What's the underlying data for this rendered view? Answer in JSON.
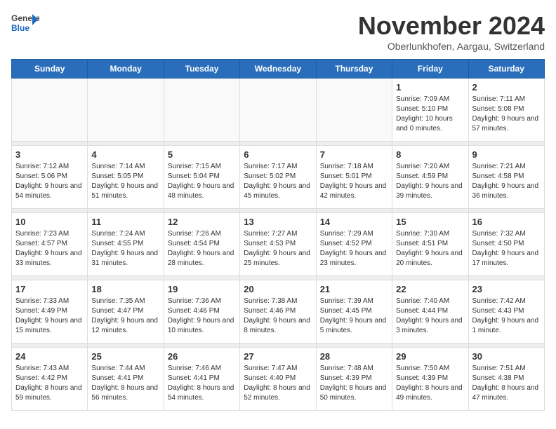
{
  "logo": {
    "text_general": "General",
    "text_blue": "Blue"
  },
  "header": {
    "title": "November 2024",
    "subtitle": "Oberlunkhofen, Aargau, Switzerland"
  },
  "weekdays": [
    "Sunday",
    "Monday",
    "Tuesday",
    "Wednesday",
    "Thursday",
    "Friday",
    "Saturday"
  ],
  "weeks": [
    [
      {
        "day": "",
        "info": ""
      },
      {
        "day": "",
        "info": ""
      },
      {
        "day": "",
        "info": ""
      },
      {
        "day": "",
        "info": ""
      },
      {
        "day": "",
        "info": ""
      },
      {
        "day": "1",
        "info": "Sunrise: 7:09 AM\nSunset: 5:10 PM\nDaylight: 10 hours and 0 minutes."
      },
      {
        "day": "2",
        "info": "Sunrise: 7:11 AM\nSunset: 5:08 PM\nDaylight: 9 hours and 57 minutes."
      }
    ],
    [
      {
        "day": "3",
        "info": "Sunrise: 7:12 AM\nSunset: 5:06 PM\nDaylight: 9 hours and 54 minutes."
      },
      {
        "day": "4",
        "info": "Sunrise: 7:14 AM\nSunset: 5:05 PM\nDaylight: 9 hours and 51 minutes."
      },
      {
        "day": "5",
        "info": "Sunrise: 7:15 AM\nSunset: 5:04 PM\nDaylight: 9 hours and 48 minutes."
      },
      {
        "day": "6",
        "info": "Sunrise: 7:17 AM\nSunset: 5:02 PM\nDaylight: 9 hours and 45 minutes."
      },
      {
        "day": "7",
        "info": "Sunrise: 7:18 AM\nSunset: 5:01 PM\nDaylight: 9 hours and 42 minutes."
      },
      {
        "day": "8",
        "info": "Sunrise: 7:20 AM\nSunset: 4:59 PM\nDaylight: 9 hours and 39 minutes."
      },
      {
        "day": "9",
        "info": "Sunrise: 7:21 AM\nSunset: 4:58 PM\nDaylight: 9 hours and 36 minutes."
      }
    ],
    [
      {
        "day": "10",
        "info": "Sunrise: 7:23 AM\nSunset: 4:57 PM\nDaylight: 9 hours and 33 minutes."
      },
      {
        "day": "11",
        "info": "Sunrise: 7:24 AM\nSunset: 4:55 PM\nDaylight: 9 hours and 31 minutes."
      },
      {
        "day": "12",
        "info": "Sunrise: 7:26 AM\nSunset: 4:54 PM\nDaylight: 9 hours and 28 minutes."
      },
      {
        "day": "13",
        "info": "Sunrise: 7:27 AM\nSunset: 4:53 PM\nDaylight: 9 hours and 25 minutes."
      },
      {
        "day": "14",
        "info": "Sunrise: 7:29 AM\nSunset: 4:52 PM\nDaylight: 9 hours and 23 minutes."
      },
      {
        "day": "15",
        "info": "Sunrise: 7:30 AM\nSunset: 4:51 PM\nDaylight: 9 hours and 20 minutes."
      },
      {
        "day": "16",
        "info": "Sunrise: 7:32 AM\nSunset: 4:50 PM\nDaylight: 9 hours and 17 minutes."
      }
    ],
    [
      {
        "day": "17",
        "info": "Sunrise: 7:33 AM\nSunset: 4:49 PM\nDaylight: 9 hours and 15 minutes."
      },
      {
        "day": "18",
        "info": "Sunrise: 7:35 AM\nSunset: 4:47 PM\nDaylight: 9 hours and 12 minutes."
      },
      {
        "day": "19",
        "info": "Sunrise: 7:36 AM\nSunset: 4:46 PM\nDaylight: 9 hours and 10 minutes."
      },
      {
        "day": "20",
        "info": "Sunrise: 7:38 AM\nSunset: 4:46 PM\nDaylight: 9 hours and 8 minutes."
      },
      {
        "day": "21",
        "info": "Sunrise: 7:39 AM\nSunset: 4:45 PM\nDaylight: 9 hours and 5 minutes."
      },
      {
        "day": "22",
        "info": "Sunrise: 7:40 AM\nSunset: 4:44 PM\nDaylight: 9 hours and 3 minutes."
      },
      {
        "day": "23",
        "info": "Sunrise: 7:42 AM\nSunset: 4:43 PM\nDaylight: 9 hours and 1 minute."
      }
    ],
    [
      {
        "day": "24",
        "info": "Sunrise: 7:43 AM\nSunset: 4:42 PM\nDaylight: 8 hours and 59 minutes."
      },
      {
        "day": "25",
        "info": "Sunrise: 7:44 AM\nSunset: 4:41 PM\nDaylight: 8 hours and 56 minutes."
      },
      {
        "day": "26",
        "info": "Sunrise: 7:46 AM\nSunset: 4:41 PM\nDaylight: 8 hours and 54 minutes."
      },
      {
        "day": "27",
        "info": "Sunrise: 7:47 AM\nSunset: 4:40 PM\nDaylight: 8 hours and 52 minutes."
      },
      {
        "day": "28",
        "info": "Sunrise: 7:48 AM\nSunset: 4:39 PM\nDaylight: 8 hours and 50 minutes."
      },
      {
        "day": "29",
        "info": "Sunrise: 7:50 AM\nSunset: 4:39 PM\nDaylight: 8 hours and 49 minutes."
      },
      {
        "day": "30",
        "info": "Sunrise: 7:51 AM\nSunset: 4:38 PM\nDaylight: 8 hours and 47 minutes."
      }
    ]
  ]
}
